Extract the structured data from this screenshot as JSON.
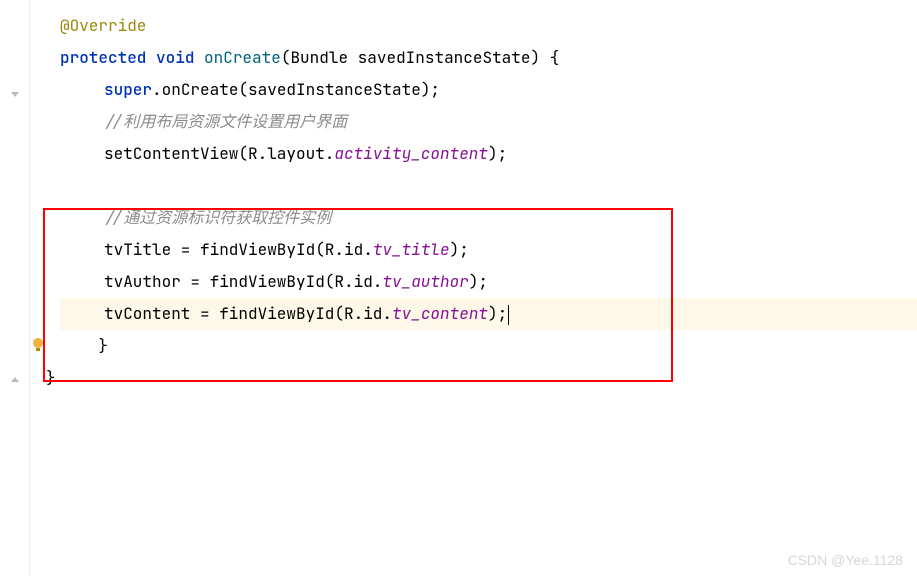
{
  "code": {
    "annotation": "@Override",
    "modifier1": "protected",
    "modifier2": "void",
    "method_name": "onCreate",
    "param_type": "Bundle",
    "param_name": "savedInstanceState",
    "super_kw": "super",
    "super_call": ".onCreate(savedInstanceState);",
    "comment1": "//利用布局资源文件设置用户界面",
    "setcontent_pre": "setContentView(R.layout.",
    "setcontent_id": "activity_content",
    "setcontent_post": ");",
    "comment2": "//通过资源标识符获取控件实例",
    "tv1_pre": "tvTitle = findViewById(R.id.",
    "tv1_id": "tv_title",
    "tv1_post": ");",
    "tv2_pre": "tvAuthor = findViewById(R.id.",
    "tv2_id": "tv_author",
    "tv2_post": ");",
    "tv3_pre": "tvContent = findViewById(R.id.",
    "tv3_id": "tv_content",
    "tv3_post": ");",
    "brace_close1": "    }",
    "brace_close2": "}"
  },
  "watermark": "CSDN @Yee.1128"
}
